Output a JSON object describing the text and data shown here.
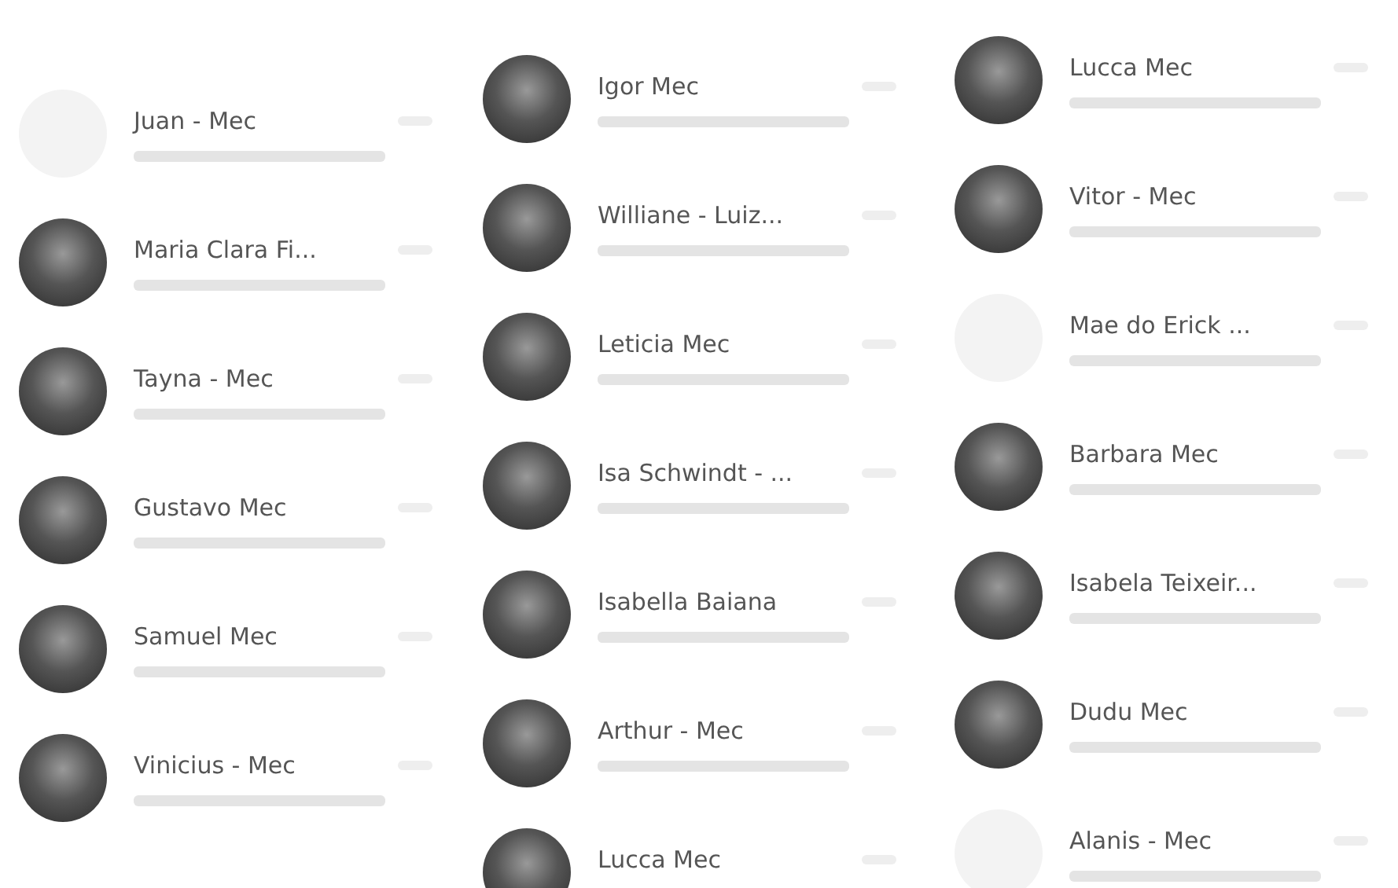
{
  "columns": [
    {
      "chats": [
        {
          "name": "Juan - Mec",
          "has_photo": false
        },
        {
          "name": "Maria Clara Fi...",
          "has_photo": true
        },
        {
          "name": "Tayna - Mec",
          "has_photo": true
        },
        {
          "name": "Gustavo Mec",
          "has_photo": true
        },
        {
          "name": "Samuel Mec",
          "has_photo": true
        },
        {
          "name": "Vinicius - Mec",
          "has_photo": true
        }
      ]
    },
    {
      "chats": [
        {
          "name": "Igor Mec",
          "has_photo": true
        },
        {
          "name": "Williane - Luiz...",
          "has_photo": true
        },
        {
          "name": "Leticia Mec",
          "has_photo": true
        },
        {
          "name": "Isa Schwindt - ...",
          "has_photo": true
        },
        {
          "name": "Isabella Baiana",
          "has_photo": true
        },
        {
          "name": "Arthur - Mec",
          "has_photo": true
        },
        {
          "name": "Lucca Mec",
          "has_photo": true
        }
      ]
    },
    {
      "chats": [
        {
          "name": "Lucca Mec",
          "has_photo": true
        },
        {
          "name": "Vitor - Mec",
          "has_photo": true
        },
        {
          "name": "Mae do Erick ...",
          "has_photo": false
        },
        {
          "name": "Barbara Mec",
          "has_photo": true
        },
        {
          "name": "Isabela Teixeir...",
          "has_photo": true
        },
        {
          "name": "Dudu Mec",
          "has_photo": true
        },
        {
          "name": "Alanis - Mec",
          "has_photo": false
        }
      ]
    }
  ]
}
